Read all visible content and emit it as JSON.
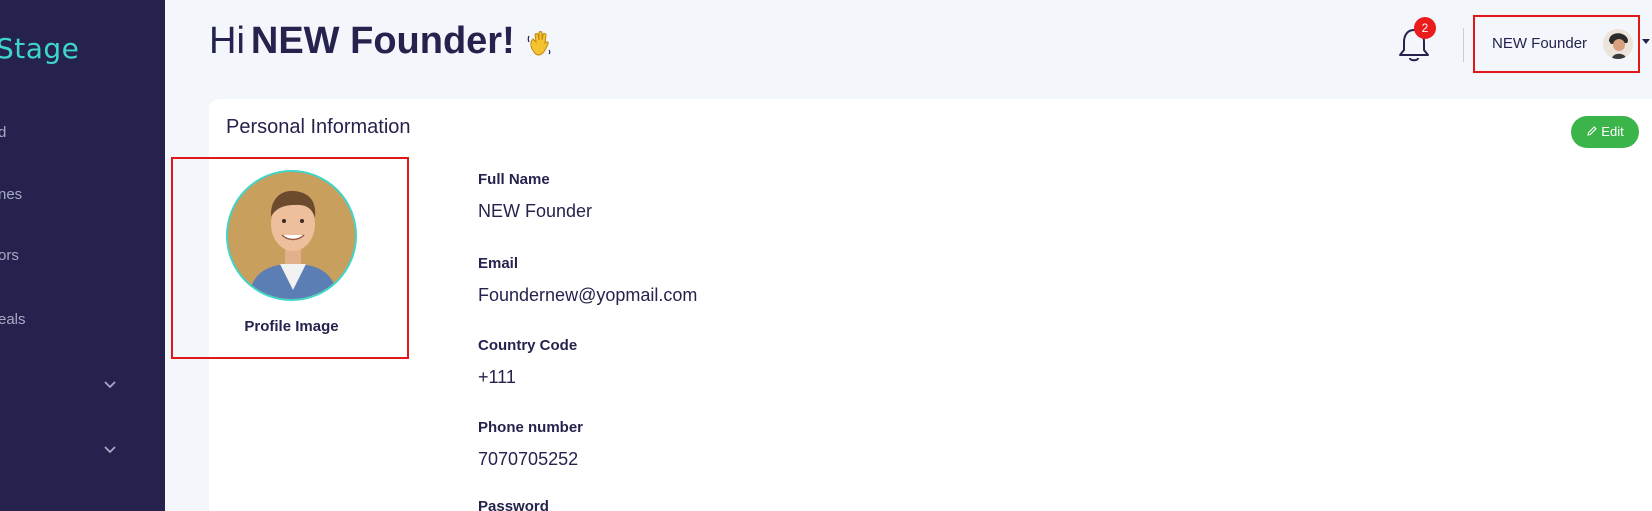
{
  "sidebar": {
    "logo": "Stage",
    "items": [
      {
        "label": "d"
      },
      {
        "label": "nes"
      },
      {
        "label": "ors"
      },
      {
        "label": "eals"
      }
    ]
  },
  "header": {
    "greeting_hi": "Hi",
    "greeting_name": "NEW Founder!",
    "notification_count": "2",
    "user_name": "NEW Founder"
  },
  "card": {
    "title": "Personal Information",
    "edit_label": "Edit",
    "profile_label": "Profile Image",
    "fields": [
      {
        "label": "Full Name",
        "value": "NEW Founder"
      },
      {
        "label": "Email",
        "value": "Foundernew@yopmail.com"
      },
      {
        "label": "Country Code",
        "value": "+111"
      },
      {
        "label": "Phone number",
        "value": "7070705252"
      },
      {
        "label": "Password",
        "value": ""
      }
    ]
  },
  "colors": {
    "sidebar_bg": "#25234d",
    "accent_teal": "#3ed6c8",
    "edit_green": "#3bb54a",
    "highlight_red": "#e01818",
    "badge_red": "#ea1c1c"
  }
}
